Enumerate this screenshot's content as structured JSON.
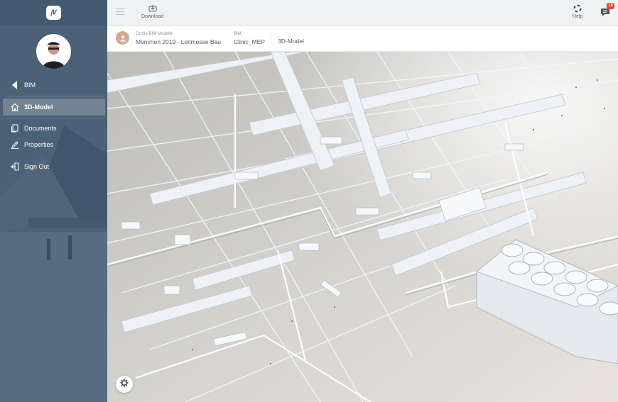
{
  "topbar": {
    "download_label": "Download",
    "help_label": "Help",
    "notification_count": "18"
  },
  "breadcrumb": {
    "project_category": "Große BIM Modelle",
    "project_name": "München 2019 - Leitmesse Bau",
    "folder_category": "BIM",
    "folder_name": "Clinic_MEP",
    "current_page": "3D-Model"
  },
  "sidebar": {
    "items": [
      {
        "label": "BIM",
        "icon": "caret-left-icon"
      },
      {
        "label": "3D-Model",
        "icon": "home-icon"
      },
      {
        "label": "Documents",
        "icon": "documents-icon"
      },
      {
        "label": "Properties",
        "icon": "pencil-icon"
      },
      {
        "label": "Sign Out",
        "icon": "sign-out-icon"
      }
    ]
  },
  "colors": {
    "sidebar": "#4b6177",
    "accent_badge": "#e8412d",
    "viewer_bg": "#d8d6d1"
  }
}
